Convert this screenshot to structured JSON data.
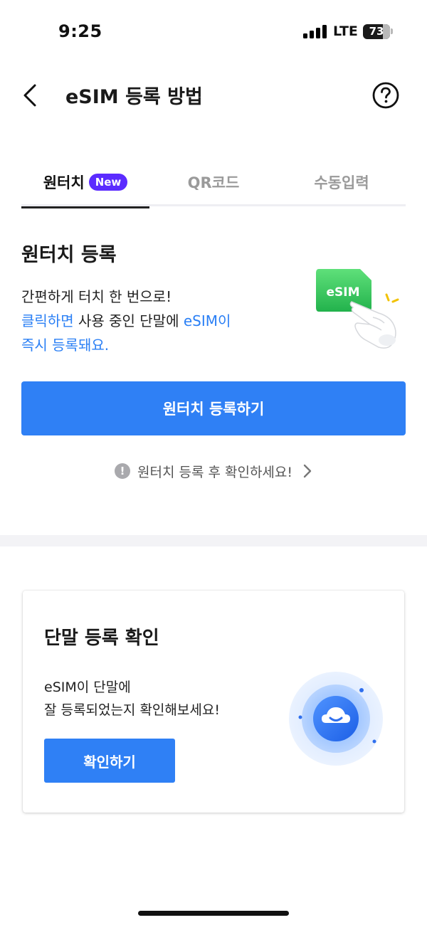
{
  "status_bar": {
    "time": "9:25",
    "network": "LTE",
    "battery": "73",
    "battery_level_percent": 73
  },
  "header": {
    "title": "eSIM 등록 방법",
    "back_icon": "chevron-left-icon",
    "help_icon": "question-circle-icon"
  },
  "tabs": [
    {
      "label": "원터치",
      "badge": "New",
      "active": true
    },
    {
      "label": "QR코드",
      "active": false
    },
    {
      "label": "수동입력",
      "active": false
    }
  ],
  "onetouch": {
    "title": "원터치 등록",
    "line1": "간편하게 터치 한 번으로!",
    "line2_highlight1": "클릭하면",
    "line2_middle": " 사용 중인 단말에 ",
    "line2_highlight2": "eSIM이",
    "line3_highlight": "즉시 등록돼요.",
    "illustration_label": "eSIM",
    "button_label": "원터치 등록하기",
    "notice_icon": "!",
    "notice_text": "원터치 등록 후 확인하세요!"
  },
  "confirm_card": {
    "title": "단말 등록 확인",
    "desc_line1": "eSIM이 단말에",
    "desc_line2": "잘 등록되었는지 확인해보세요!",
    "button_label": "확인하기",
    "illustration_icon": "cloud-check-icon"
  },
  "colors": {
    "primary": "#2f80f5",
    "highlight_text": "#2a7ff5",
    "badge": "#5b2bff",
    "esim_chip": "#34c759"
  }
}
